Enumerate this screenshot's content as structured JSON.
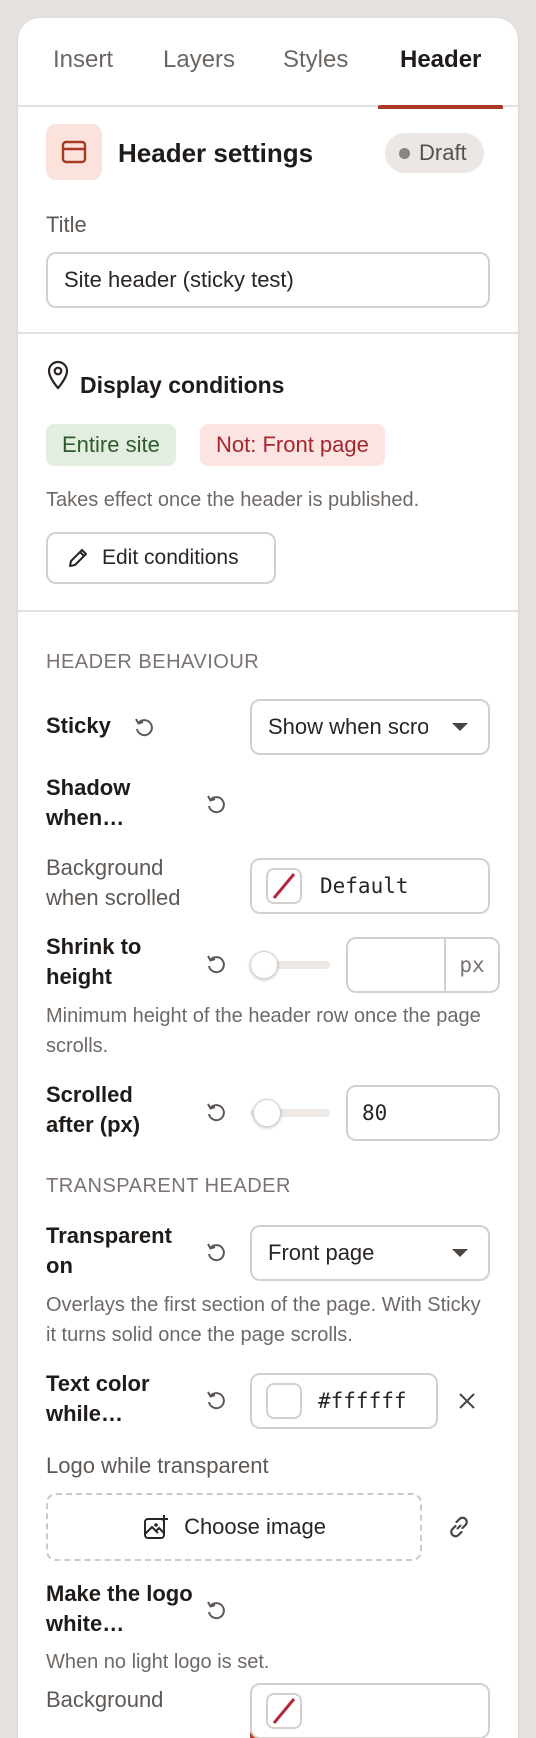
{
  "tabs": [
    "Insert",
    "Layers",
    "Styles",
    "Header"
  ],
  "header_settings": {
    "title": "Header settings",
    "status": "Draft",
    "title_label": "Title",
    "title_value": "Site header (sticky test)"
  },
  "display_conditions": {
    "title": "Display conditions",
    "chips": [
      "Entire site",
      "Not: Front page"
    ],
    "help": "Takes effect once the header is published.",
    "edit_button": "Edit conditions"
  },
  "behaviour": {
    "heading": "HEADER BEHAVIOUR",
    "sticky": {
      "label": "Sticky",
      "value": "Show when scrolling up"
    },
    "shadow": {
      "label": "Shadow when…",
      "on": true
    },
    "background": {
      "label": "Background when scrolled",
      "value": "Default"
    },
    "shrink": {
      "label": "Shrink to height",
      "value": "",
      "unit": "px",
      "slider_fraction": 0.0,
      "help": "Minimum height of the header row once the page scrolls."
    },
    "scrolled": {
      "label": "Scrolled after (px)",
      "value": "80",
      "slider_fraction": 0.05
    }
  },
  "transparent": {
    "heading": "TRANSPARENT HEADER",
    "on": {
      "label": "Transparent on",
      "value": "Front page",
      "help": "Overlays the first section of the page. With Sticky it turns solid once the page scrolls."
    },
    "text_color": {
      "label": "Text color while…",
      "value": "#ffffff"
    },
    "logo": {
      "label": "Logo while transparent",
      "button": "Choose image"
    },
    "white_logo": {
      "label": "Make the logo white…",
      "on": true,
      "help": "When no light logo is set."
    },
    "background": {
      "label": "Background"
    }
  },
  "colors": {
    "accent": "#a83a24",
    "green_chip_bg": "#e3eee1",
    "red_chip_bg": "#fbe4e2"
  }
}
